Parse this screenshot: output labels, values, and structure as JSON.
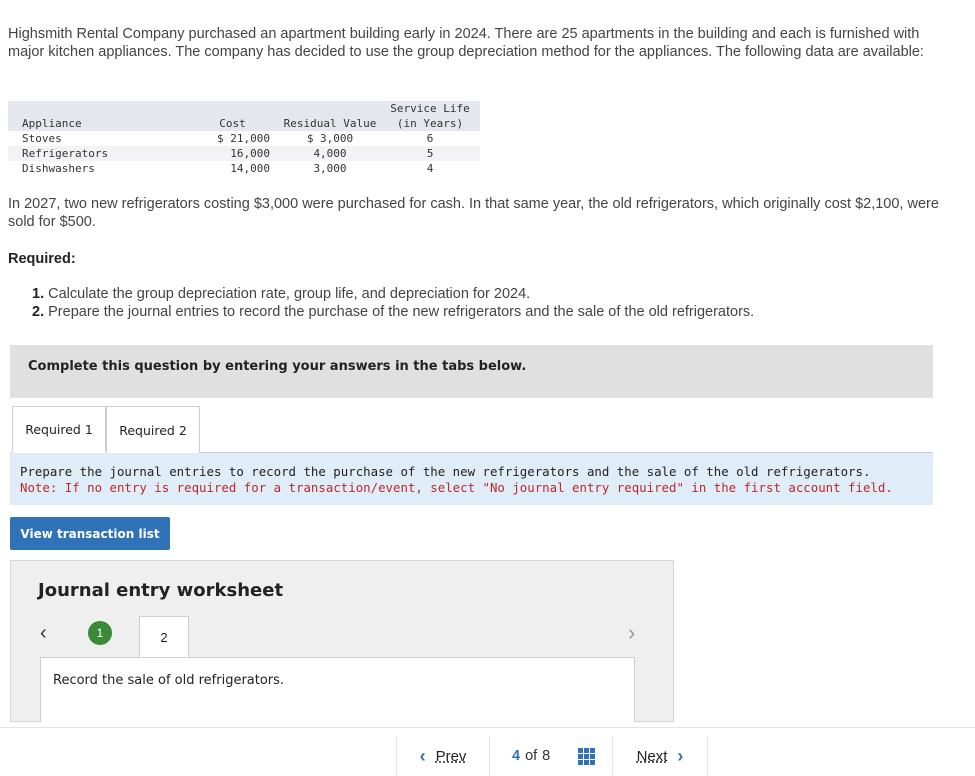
{
  "intro": "Highsmith Rental Company purchased an apartment building early in 2024. There are 25 apartments in the building and each is furnished with major kitchen appliances. The company has decided to use the group depreciation method for the appliances. The following data are available:",
  "table": {
    "headers": {
      "appliance": "Appliance",
      "cost": "Cost",
      "residual": "Residual Value",
      "life_line1": "Service Life",
      "life_line2": "(in Years)"
    },
    "rows": [
      {
        "appliance": "Stoves",
        "cost": "$ 21,000",
        "residual": "$ 3,000",
        "life": "6"
      },
      {
        "appliance": "Refrigerators",
        "cost": "16,000",
        "residual": "4,000",
        "life": "5"
      },
      {
        "appliance": "Dishwashers",
        "cost": "14,000",
        "residual": "3,000",
        "life": "4"
      }
    ]
  },
  "paragraph2": "In 2027, two new refrigerators costing $3,000 were purchased for cash. In that same year, the old refrigerators, which originally cost $2,100, were sold for $500.",
  "required_heading": "Required:",
  "required_items": [
    {
      "num": "1.",
      "text": "Calculate the group depreciation rate, group life, and depreciation for 2024."
    },
    {
      "num": "2.",
      "text": "Prepare the journal entries to record the purchase of the new refrigerators and the sale of the old refrigerators."
    }
  ],
  "banner": "Complete this question by entering your answers in the tabs below.",
  "tabs": [
    "Required 1",
    "Required 2"
  ],
  "info": {
    "line1": "Prepare the journal entries to record the purchase of the new refrigerators and the sale of the old refrigerators.",
    "line2": "Note: If no entry is required for a transaction/event, select \"No journal entry required\" in the first account field."
  },
  "view_button": "View transaction list",
  "worksheet": {
    "title": "Journal entry worksheet",
    "steps": [
      "1",
      "2"
    ],
    "instruction": "Record the sale of old refrigerators."
  },
  "pager": {
    "prev": "Prev",
    "current": "4",
    "of": "of",
    "total": "8",
    "next": "Next"
  },
  "colors": {
    "accent": "#2f72b8",
    "note_red": "#c0262d",
    "step_green": "#3a8a3a",
    "info_bg": "#deedf7"
  }
}
